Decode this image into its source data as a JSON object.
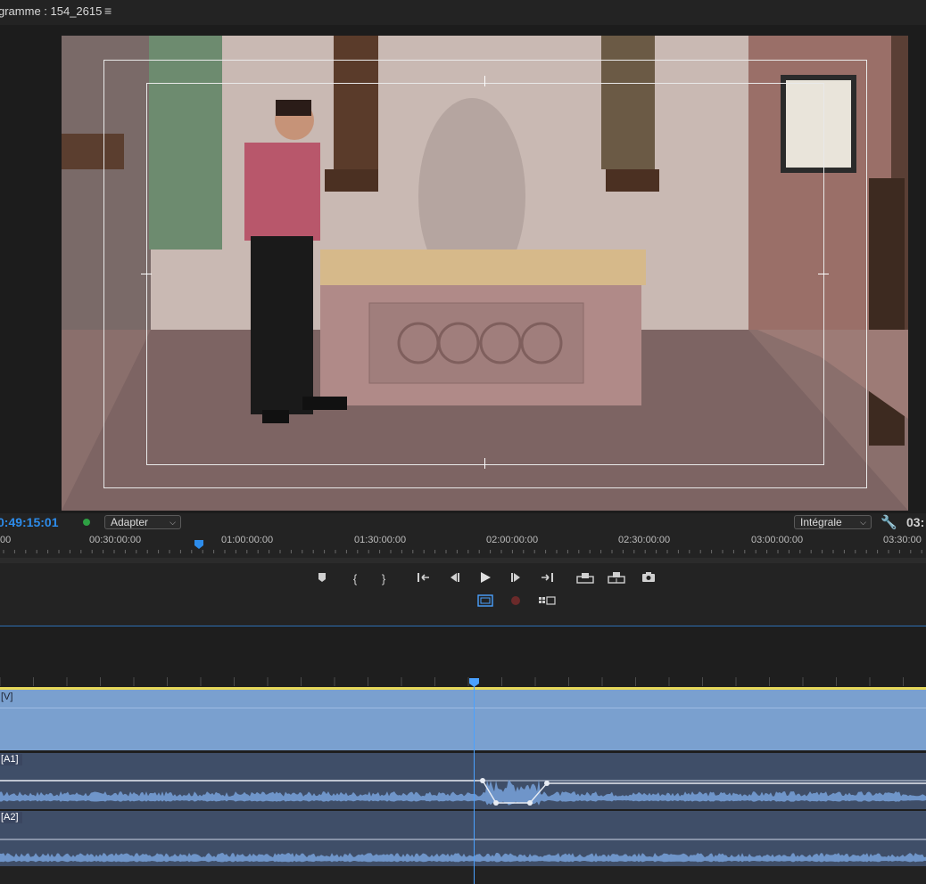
{
  "header": {
    "title": "gramme : 154_2615",
    "menu_icon": "hamburger-menu-icon"
  },
  "monitor": {
    "timecode": "0:49:15:01",
    "timecode_right": "03:",
    "zoom_select": "Adapter",
    "quality_select": "Intégrale",
    "status_color": "#2ea043",
    "accent_color": "#2d8ceb"
  },
  "ruler": {
    "labels": [
      "00",
      "00:30:00:00",
      "01:00:00:00",
      "01:30:00:00",
      "02:00:00:00",
      "02:30:00:00",
      "03:00:00:00",
      "03:30:00"
    ]
  },
  "transport": {
    "buttons": [
      "add-marker-icon",
      "mark-in-icon",
      "mark-out-icon",
      "go-to-in-icon",
      "step-back-icon",
      "play-icon",
      "step-forward-icon",
      "go-to-out-icon",
      "lift-icon",
      "extract-icon",
      "export-frame-icon",
      "safe-margins-icon",
      "record-icon",
      "multi-camera-icon"
    ]
  },
  "timeline": {
    "tracks": {
      "v_label": "[V]",
      "a1_label": "[A1]",
      "a2_label": "[A2]"
    },
    "track_color": "#7aa0cf",
    "audio_color": "#3f4e68"
  }
}
